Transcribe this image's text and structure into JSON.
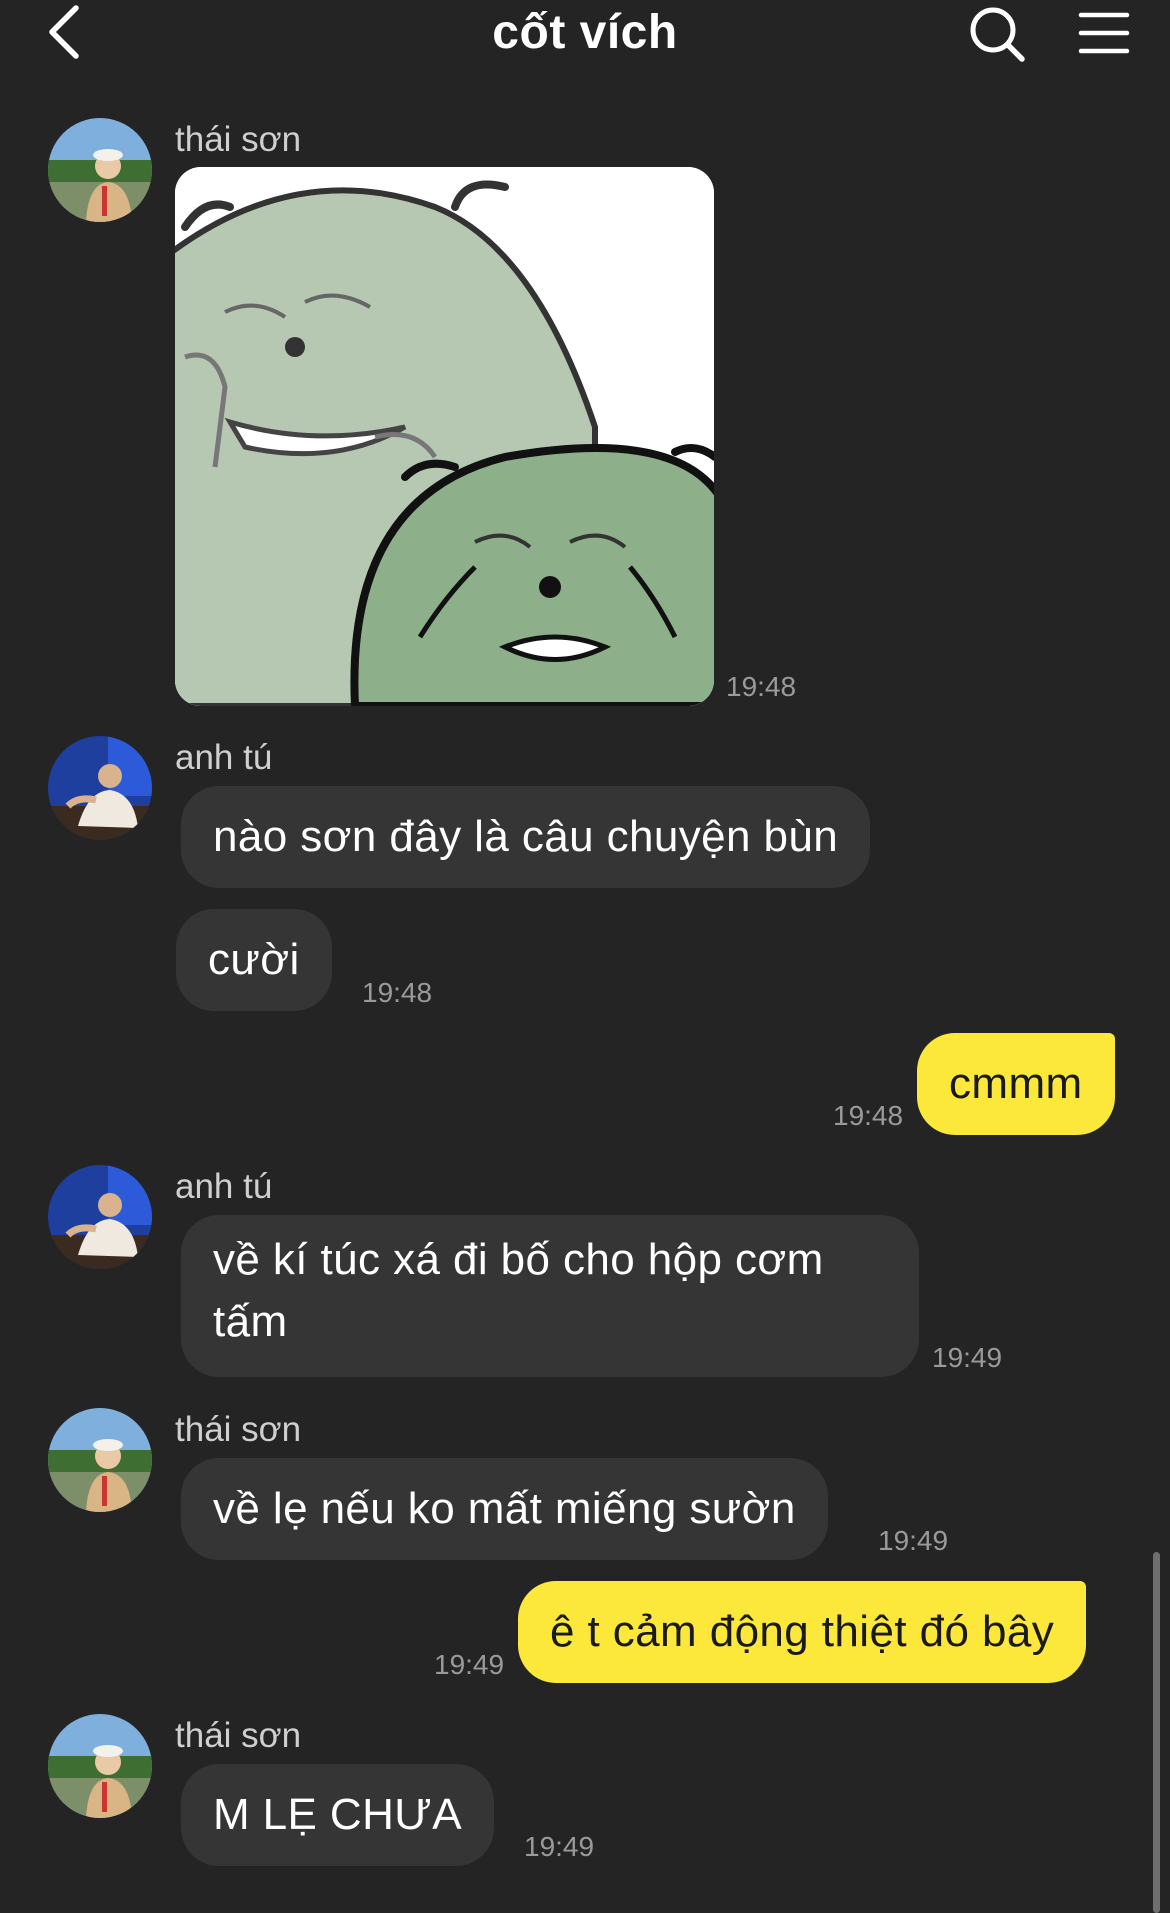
{
  "header": {
    "title": "cốt vích",
    "back_icon": "chevron-left-icon",
    "search_icon": "search-icon",
    "menu_icon": "hamburger-menu-icon"
  },
  "colors": {
    "background": "#242424",
    "incoming_bubble": "#353535",
    "outgoing_bubble": "#fbe83a"
  },
  "messages": [
    {
      "sender": "thái sơn",
      "type": "sticker",
      "time": "19:48"
    },
    {
      "sender": "anh tú",
      "text": "nào sơn đây là câu chuyện bùn"
    },
    {
      "text": "cười",
      "time": "19:48"
    },
    {
      "outgoing": true,
      "text": "cmmm",
      "time": "19:48"
    },
    {
      "sender": "anh tú",
      "text": "về kí túc xá đi bố cho hộp cơm tấm",
      "time": "19:49"
    },
    {
      "sender": "thái sơn",
      "text": "về lẹ nếu ko mất miếng sườn",
      "time": "19:49"
    },
    {
      "outgoing": true,
      "text": "ê t cảm động thiệt đó bây",
      "time": "19:49"
    },
    {
      "sender": "thái sơn",
      "text": "M LẸ CHƯA",
      "time": "19:49"
    }
  ]
}
